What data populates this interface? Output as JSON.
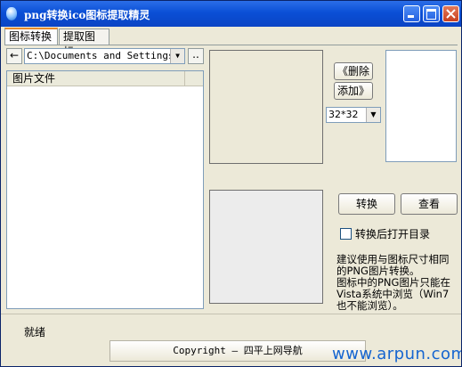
{
  "window": {
    "title": "png转换ico图标提取精灵"
  },
  "tabs": [
    {
      "label": "图标转换",
      "active": true
    },
    {
      "label": "提取图标",
      "active": false
    }
  ],
  "toolbar": {
    "back_glyph": "←",
    "path_value": "C:\\Documents and Settings\\A",
    "browse_label": ".."
  },
  "file_list": {
    "column_header": "图片文件"
  },
  "icon_buttons": {
    "delete_label": "《删除",
    "add_label": "添加》"
  },
  "size_select": {
    "value": "32*32"
  },
  "actions": {
    "convert_label": "转换",
    "view_label": "查看"
  },
  "option": {
    "open_dir_label": "转换后打开目录",
    "checked": false
  },
  "note": {
    "line1": "建议使用与图标尺寸相同的PNG图片转换。",
    "line2": "图标中的PNG图片只能在Vista系统中浏览（Win7也不能浏览）。"
  },
  "status": {
    "text": "就绪"
  },
  "footer": {
    "copyright": "Copyright — 四平上网导航"
  },
  "watermark": {
    "text": "www.arpun.com"
  }
}
